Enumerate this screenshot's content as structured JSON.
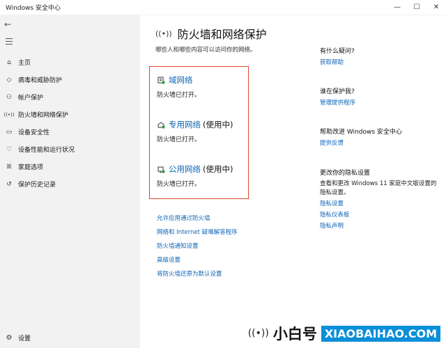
{
  "window": {
    "title": "Windows 安全中心",
    "minimize_glyph": "—",
    "maximize_glyph": "☐",
    "close_glyph": "✕"
  },
  "sidebar": {
    "back_glyph": "←",
    "items": [
      {
        "icon": "home-icon",
        "glyph": "⌂",
        "label": "主页"
      },
      {
        "icon": "shield-icon",
        "glyph": "◇",
        "label": "病毒和威胁防护"
      },
      {
        "icon": "person-icon",
        "glyph": "⚇",
        "label": "帐户保护"
      },
      {
        "icon": "wifi-icon",
        "glyph": "((•))",
        "label": "防火墙和网络保护"
      },
      {
        "icon": "app-window-icon",
        "glyph": "▭",
        "label": "设备安全性"
      },
      {
        "icon": "heart-icon",
        "glyph": "♡",
        "label": "设备性能和运行状况"
      },
      {
        "icon": "family-icon",
        "glyph": "ꕤ",
        "label": "家庭选项"
      },
      {
        "icon": "history-icon",
        "glyph": "↺",
        "label": "保护历史记录"
      }
    ],
    "settings": {
      "icon": "gear-icon",
      "glyph": "⚙",
      "label": "设置"
    }
  },
  "main": {
    "title_glyph": "((•))",
    "title": "防火墙和网络保护",
    "subtitle": "哪些人和哪些内容可以访问你的网络。",
    "networks": [
      {
        "icon": "domain-network-icon",
        "name": "域网络",
        "in_use": "",
        "status": "防火墙已打开。"
      },
      {
        "icon": "private-network-icon",
        "name": "专用网络",
        "in_use": "(使用中)",
        "status": "防火墙已打开。"
      },
      {
        "icon": "public-network-icon",
        "name": "公用网络",
        "in_use": "(使用中)",
        "status": "防火墙已打开。"
      }
    ],
    "links": [
      "允许应用通过防火墙",
      "网络和 Internet 疑难解答程序",
      "防火墙通知设置",
      "高级设置",
      "将防火墙还原为默认设置"
    ]
  },
  "right": {
    "question": {
      "heading": "有什么疑问?",
      "link": "获取帮助"
    },
    "protect": {
      "heading": "谁在保护我?",
      "link": "管理提供程序"
    },
    "improve": {
      "heading": "帮助改进 Windows 安全中心",
      "link": "提供反馈"
    },
    "privacy": {
      "heading": "更改你的隐私设置",
      "text": "查看和更改 Windows 11 家庭中文版设置的隐私设置。",
      "links": [
        "隐私设置",
        "隐私仪表板",
        "隐私声明"
      ]
    }
  },
  "watermark": {
    "glyph": "((•))",
    "cn": "小白号",
    "en": "XIAOBAIHAO.COM"
  },
  "colors": {
    "accent": "#0f65b6",
    "highlight_box": "#e0452c",
    "sidebar_bg": "#f2f2f2"
  }
}
